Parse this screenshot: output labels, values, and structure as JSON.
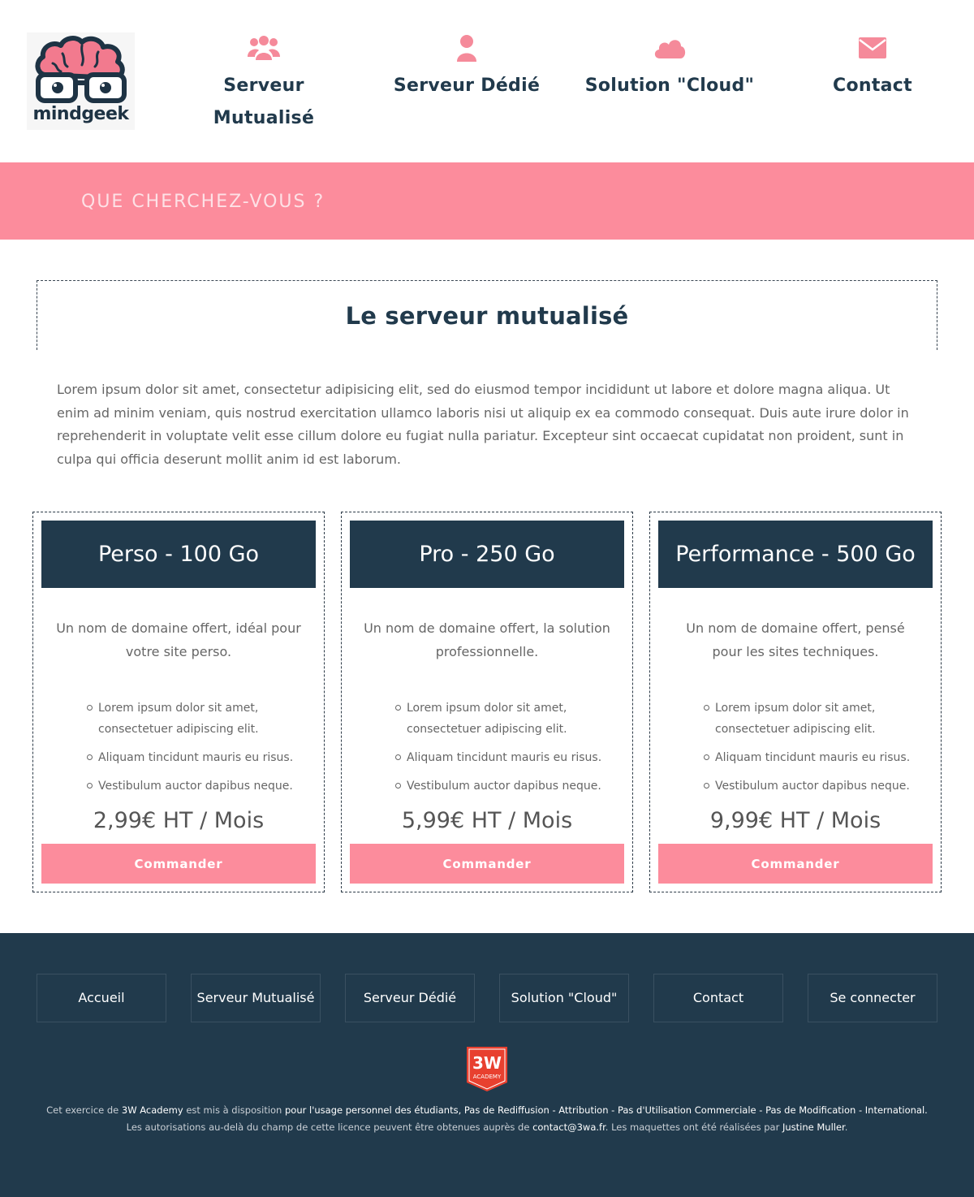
{
  "header": {
    "logo_text": "mindgeek",
    "nav": [
      {
        "label": "Serveur Mutualisé",
        "icon": "users-icon"
      },
      {
        "label": "Serveur Dédié",
        "icon": "user-icon"
      },
      {
        "label": "Solution \"Cloud\"",
        "icon": "cloud-icon"
      },
      {
        "label": "Contact",
        "icon": "envelope-icon"
      }
    ]
  },
  "search": {
    "placeholder": "QUE CHERCHEZ-VOUS ?"
  },
  "main": {
    "title": "Le serveur mutualisé",
    "intro": "Lorem ipsum dolor sit amet, consectetur adipisicing elit, sed do eiusmod tempor incididunt ut labore et dolore magna aliqua. Ut enim ad minim veniam, quis nostrud exercitation ullamco laboris nisi ut aliquip ex ea commodo consequat. Duis aute irure dolor in reprehenderit in voluptate velit esse cillum dolore eu fugiat nulla pariatur. Excepteur sint occaecat cupidatat non proident, sunt in culpa qui officia deserunt mollit anim id est laborum."
  },
  "plans": [
    {
      "name": "Perso - 100 Go",
      "desc": "Un nom de domaine offert, idéal pour votre site perso.",
      "features": [
        "Lorem ipsum dolor sit amet, consectetuer adipiscing elit.",
        "Aliquam tincidunt mauris eu risus.",
        "Vestibulum auctor dapibus neque."
      ],
      "price": "2,99€ HT / Mois",
      "button": "Commander"
    },
    {
      "name": "Pro - 250 Go",
      "desc": "Un nom de domaine offert, la solution professionnelle.",
      "features": [
        "Lorem ipsum dolor sit amet, consectetuer adipiscing elit.",
        "Aliquam tincidunt mauris eu risus.",
        "Vestibulum auctor dapibus neque."
      ],
      "price": "5,99€ HT / Mois",
      "button": "Commander"
    },
    {
      "name": "Performance - 500 Go",
      "desc": "Un nom de domaine offert, pensé pour les sites techniques.",
      "features": [
        "Lorem ipsum dolor sit amet, consectetuer adipiscing elit.",
        "Aliquam tincidunt mauris eu risus.",
        "Vestibulum auctor dapibus neque."
      ],
      "price": "9,99€ HT / Mois",
      "button": "Commander"
    }
  ],
  "footer": {
    "nav": [
      "Accueil",
      "Serveur Mutualisé",
      "Serveur Dédié",
      "Solution \"Cloud\"",
      "Contact",
      "Se connecter"
    ],
    "badge_text": "3W",
    "badge_sub": "ACADEMY",
    "legal": {
      "l1_a": "Cet exercice de ",
      "l1_b": "3W Academy",
      "l1_c": " est mis à disposition ",
      "l1_d": "pour l'usage personnel des étudiants, Pas de Rediffusion - Attribution - Pas d'Utilisation Commerciale - Pas de Modification - International.",
      "l2_a": "Les autorisations au-delà du champ de cette licence peuvent être obtenues auprès de ",
      "l2_b": "contact@3wa.fr",
      "l2_c": ". Les maquettes ont été réalisées par ",
      "l2_d": "Justine Muller",
      "l2_e": "."
    }
  },
  "colors": {
    "pink": "#fc8c9c",
    "navy": "#213a4c"
  }
}
